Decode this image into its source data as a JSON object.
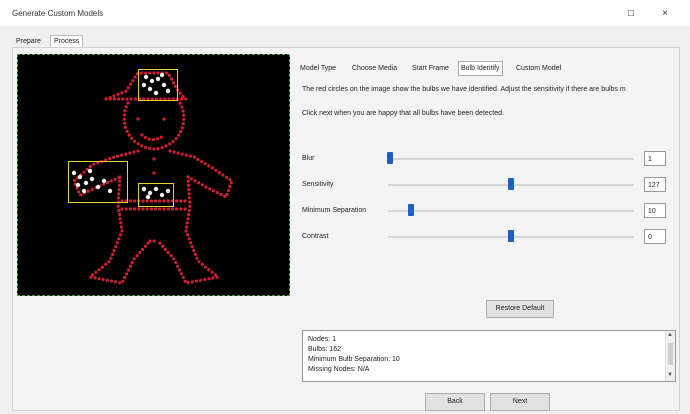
{
  "window": {
    "title": "Generate Custom Models",
    "maximize_icon": "□",
    "close_icon": "×"
  },
  "outer_tabs": [
    "Prepare",
    "Process"
  ],
  "inner_tabs": [
    "Model Type",
    "Choose Media",
    "Start Frame",
    "Bulb Identify",
    "Custom Model"
  ],
  "active_inner_tab": "Bulb Identify",
  "instructions": {
    "line1": "The red circles on the image show the bulbs we have identified. Adjust the sensitivity if there are bulbs m",
    "line2": "Click next when you are happy that all bulbs have been detected."
  },
  "sliders": [
    {
      "label": "Blur",
      "value": "1",
      "level": 0.02
    },
    {
      "label": "Sensitivity",
      "value": "127",
      "level": 0.5
    },
    {
      "label": "Minimum Separation",
      "value": "10",
      "level": 0.1
    },
    {
      "label": "Contrast",
      "value": "0",
      "level": 0.5
    }
  ],
  "buttons": {
    "restore": "Restore Default",
    "back": "Back",
    "next": "Next"
  },
  "log": [
    "Nodes: 1",
    "Bulbs: 162",
    "Minimum Bulb Separation: 10",
    "Missing Nodes: N/A"
  ],
  "colors": {
    "accent": "#1f5fbf",
    "bulb": "#cc1f2f",
    "highlight": "#e8d23a"
  }
}
